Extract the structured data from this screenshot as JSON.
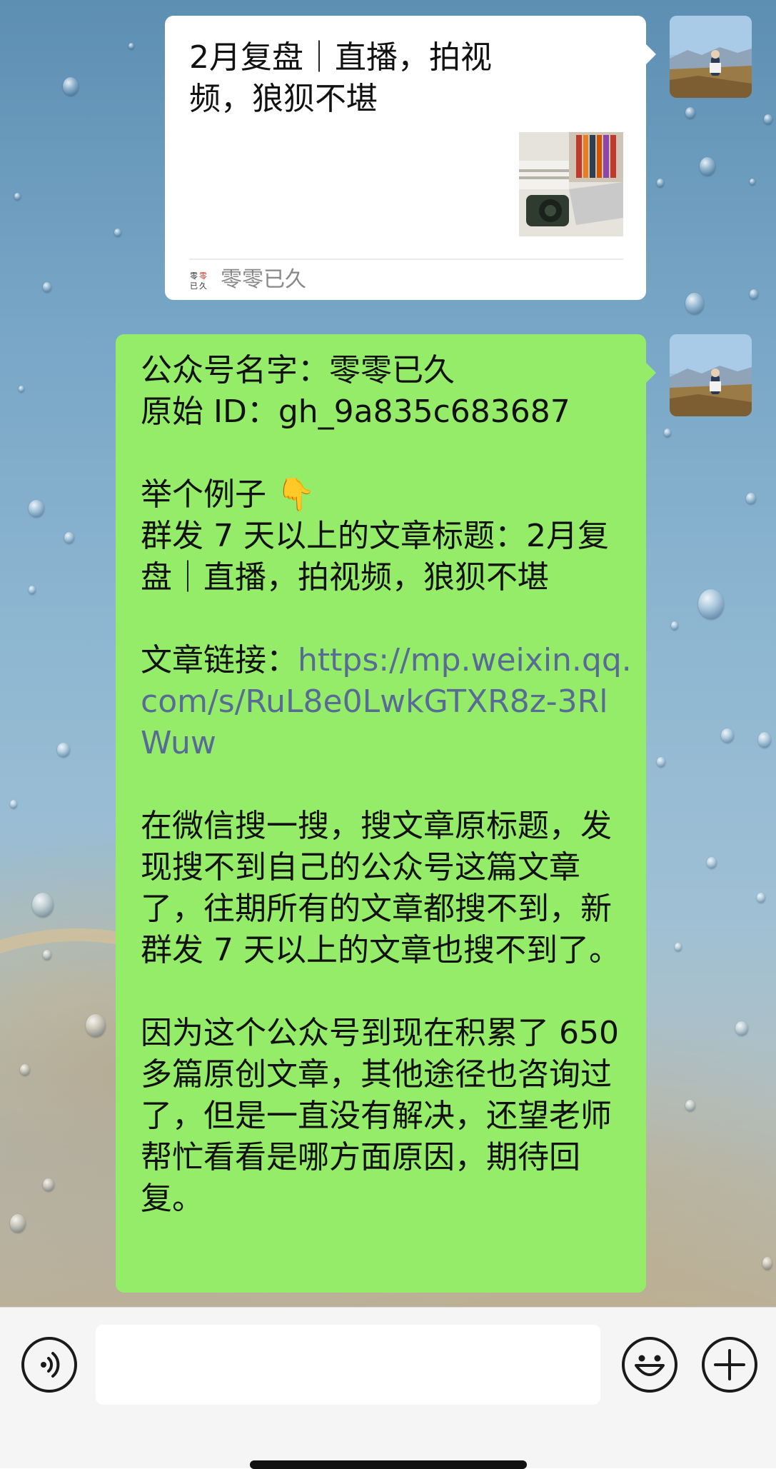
{
  "chat": {
    "article_card": {
      "title": "2月复盘｜直播，拍视频，狼狈不堪",
      "source": "零零已久"
    },
    "message": {
      "line1": "公众号名字：零零已久",
      "line2": "原始 ID：gh_9a835c683687",
      "line3": "举个例子 👇",
      "line4": "群发 7 天以上的文章标题：2月复盘｜直播，拍视频，狼狈不堪",
      "link_label": "文章链接：",
      "link_url": "https://mp.weixin.qq.com/s/RuL8e0LwkGTXR8z-3RlWuw",
      "para1": "在微信搜一搜，搜文章原标题，发现搜不到自己的公众号这篇文章了，往期所有的文章都搜不到，新群发 7 天以上的文章也搜不到了。",
      "para2": "因为这个公众号到现在积累了 650 多篇原创文章，其他途径也咨询过了，但是一直没有解决，还望老师帮忙看看是哪方面原因，期待回复。"
    }
  },
  "input_bar": {
    "voice_icon": "voice-icon",
    "emoji_icon": "emoji-icon",
    "add_icon": "plus-icon"
  },
  "colors": {
    "bubble_green": "#95ec69",
    "link": "#576b95"
  }
}
